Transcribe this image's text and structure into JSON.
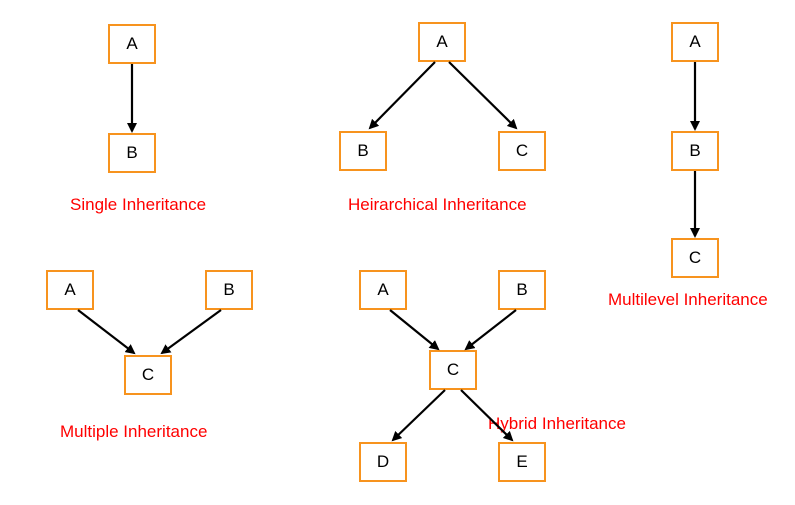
{
  "diagrams": {
    "single": {
      "caption": "Single Inheritance",
      "nodes": {
        "A": "A",
        "B": "B"
      },
      "edges": [
        [
          "A",
          "B"
        ]
      ]
    },
    "hierarchical": {
      "caption": "Heirarchical Inheritance",
      "nodes": {
        "A": "A",
        "B": "B",
        "C": "C"
      },
      "edges": [
        [
          "A",
          "B"
        ],
        [
          "A",
          "C"
        ]
      ]
    },
    "multilevel": {
      "caption": "Multilevel Inheritance",
      "nodes": {
        "A": "A",
        "B": "B",
        "C": "C"
      },
      "edges": [
        [
          "A",
          "B"
        ],
        [
          "B",
          "C"
        ]
      ]
    },
    "multiple": {
      "caption": "Multiple Inheritance",
      "nodes": {
        "A": "A",
        "B": "B",
        "C": "C"
      },
      "edges": [
        [
          "A",
          "C"
        ],
        [
          "B",
          "C"
        ]
      ]
    },
    "hybrid": {
      "caption": "Hybrid Inheritance",
      "nodes": {
        "A": "A",
        "B": "B",
        "C": "C",
        "D": "D",
        "E": "E"
      },
      "edges": [
        [
          "A",
          "C"
        ],
        [
          "B",
          "C"
        ],
        [
          "C",
          "D"
        ],
        [
          "C",
          "E"
        ]
      ]
    }
  }
}
